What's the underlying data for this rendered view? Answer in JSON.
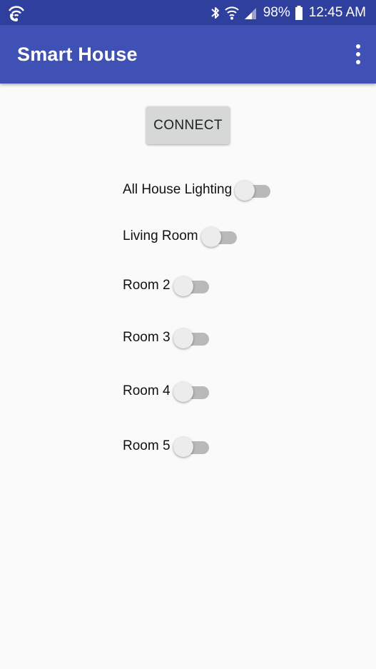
{
  "status_bar": {
    "battery_percent": "98%",
    "time": "12:45 AM",
    "icons": [
      "wifi-calling-icon",
      "bluetooth-icon",
      "wifi-icon",
      "cellular-signal-icon",
      "battery-icon"
    ]
  },
  "app_bar": {
    "title": "Smart House",
    "menu_icon": "overflow-menu-icon"
  },
  "connect_button": {
    "label": "CONNECT"
  },
  "switches": [
    {
      "label": "All House Lighting",
      "checked": false
    },
    {
      "label": "Living Room",
      "checked": false
    },
    {
      "label": "Room 2",
      "checked": false
    },
    {
      "label": "Room 3",
      "checked": false
    },
    {
      "label": "Room 4",
      "checked": false
    },
    {
      "label": "Room 5",
      "checked": false
    }
  ],
  "colors": {
    "primary": "#3f51b5",
    "primary_dark": "#2f3f9e",
    "background": "#fafafa",
    "button_gray": "#d6d7d7",
    "switch_track_off": "#b9b9b9",
    "switch_thumb_off": "#ececec"
  }
}
